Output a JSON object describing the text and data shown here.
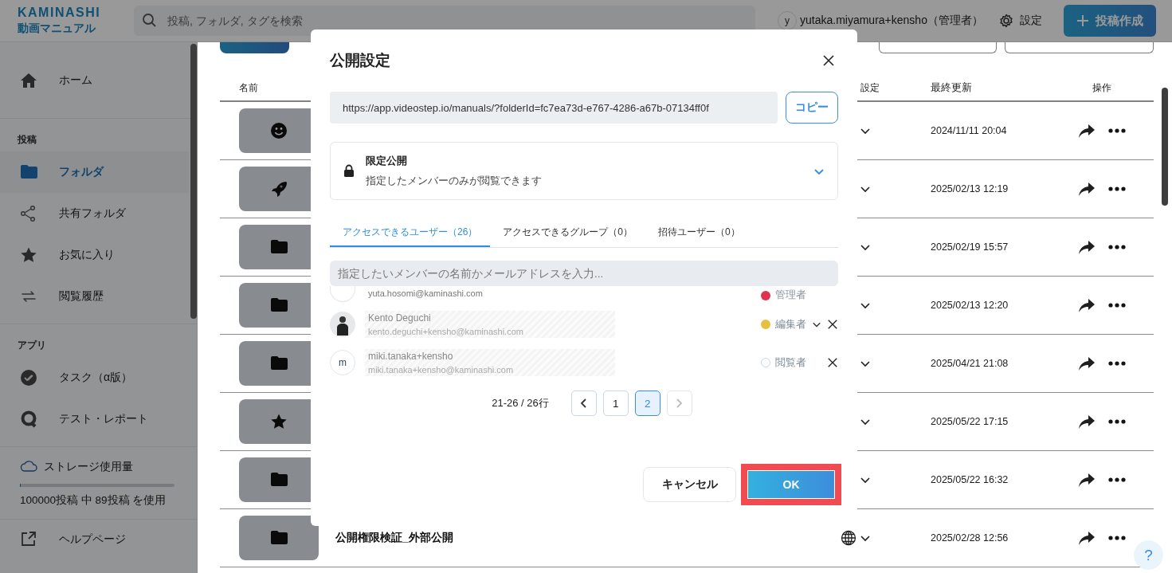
{
  "header": {
    "logo": {
      "brand": "KAMINASHI",
      "product": "動画マニュアル"
    },
    "search": {
      "placeholder": "投稿, フォルダ, タグを検索"
    },
    "user": {
      "initial": "y",
      "name": "yutaka.miyamura+kensho（管理者）"
    },
    "settings_label": "設定",
    "create_button": "投稿作成"
  },
  "sidebar": {
    "home": "ホーム",
    "groups": [
      {
        "heading": "投稿",
        "items": [
          {
            "label": "フォルダ",
            "selected": true
          },
          {
            "label": "共有フォルダ",
            "selected": false
          },
          {
            "label": "お気に入り",
            "selected": false
          },
          {
            "label": "閲覧履歴",
            "selected": false
          }
        ]
      },
      {
        "heading": "アプリ",
        "items": [
          {
            "label": "タスク（α版）",
            "selected": false
          },
          {
            "label": "テスト・レポート",
            "selected": false
          }
        ]
      }
    ],
    "storage": {
      "label": "ストレージ使用量",
      "level": 0.001,
      "usage": "100000投稿 中 89投稿 を使用"
    },
    "help": "ヘルプページ"
  },
  "table": {
    "columns": [
      "名前",
      "設定",
      "最終更新",
      "操作"
    ],
    "rows": [
      {
        "updated": "2024/11/11 20:04"
      },
      {
        "updated": "2025/02/13 12:19"
      },
      {
        "updated": "2025/02/19 15:57"
      },
      {
        "updated": "2025/02/13 12:20"
      },
      {
        "updated": "2025/04/21 21:08"
      },
      {
        "updated": "2025/05/22 17:15"
      },
      {
        "updated": "2025/05/22 16:32"
      },
      {
        "name": "公開権限検証_外部公開",
        "public": true,
        "updated": "2025/02/28 12:56"
      }
    ]
  },
  "help_button": "?",
  "dialog": {
    "title": "公開設定",
    "url": "https://app.videostep.io/manuals/?folderId=fc7ea73d-e767-4286-a67b-07134ff0f",
    "copy_button": "コピー",
    "visibility": {
      "label": "限定公開",
      "description": "指定したメンバーのみが閲覧できます"
    },
    "tabs": [
      {
        "label": "アクセスできるユーザー（26）",
        "selected": true
      },
      {
        "label": "アクセスできるグループ（0）",
        "selected": false
      },
      {
        "label": "招待ユーザー（0）",
        "selected": false
      }
    ],
    "member_search": {
      "placeholder": "指定したいメンバーの名前かメールアドレスを入力..."
    },
    "members": [
      {
        "kind": "initial",
        "email": "yuta.hosomi@kaminashi.com",
        "role": "管理者",
        "dot": {
          "kind": "filled",
          "color": "#e0334f"
        },
        "editable": false,
        "removable": false
      },
      {
        "kind": "photo",
        "name": "Kento Deguchi",
        "email": "kento.deguchi+kensho@kaminashi.com",
        "role": "編集者",
        "dot": {
          "kind": "filled",
          "color": "#e8c040"
        },
        "editable": true,
        "removable": true
      },
      {
        "kind": "initial",
        "initial": "m",
        "name": "miki.tanaka+kensho",
        "email": "miki.tanaka+kensho@kaminashi.com",
        "role": "閲覧者",
        "dot": {
          "kind": "outline",
          "color": "#c9d6e3"
        },
        "editable": false,
        "removable": true
      }
    ],
    "pagination": {
      "range": "21-26 / 26行",
      "prev_disabled": false,
      "next_disabled": true,
      "pages": [
        {
          "label": "1",
          "selected": false
        },
        {
          "label": "2",
          "selected": true
        }
      ]
    },
    "buttons": [
      {
        "kind": "secondary",
        "label": "キャンセル",
        "highlighted": false
      },
      {
        "kind": "primary",
        "label": "OK",
        "highlighted": true
      }
    ]
  }
}
